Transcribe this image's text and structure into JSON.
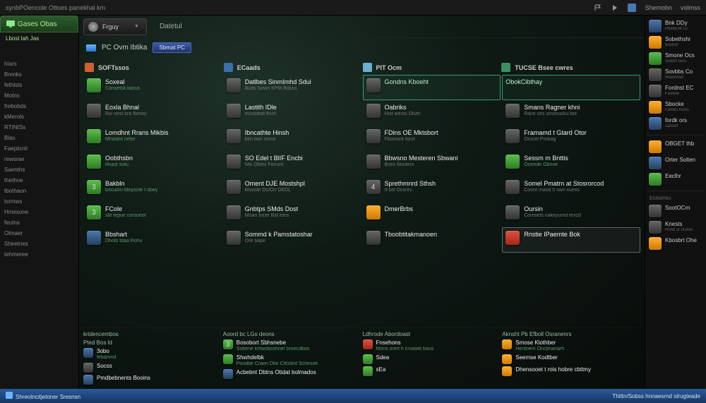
{
  "topbar": {
    "title": "synbPOencole Ottoes panekhal km",
    "right": [
      "Shemobn",
      "volmss"
    ]
  },
  "lsb": {
    "tab": "Gases Obas",
    "sub": "Lbost lah Jas",
    "cats": [
      "hIars",
      "Brenks",
      "fethists",
      "Motns",
      "frebobds",
      "kMerols",
      "RTINISs",
      "Blas",
      "Faeplontl",
      "rewsrae",
      "Saenths",
      "thethoe",
      "tbothaon",
      "tsrmws",
      "Hmesone",
      "feutns",
      "Olmaer",
      "Sheetnes",
      "tehmeree"
    ]
  },
  "hdr": {
    "dd": "Frguy",
    "tab": "Datetul"
  },
  "crumb": {
    "text": "PC Ovm Ibtika",
    "pill": "Sbmat PC"
  },
  "cols": [
    "SOFTssos",
    "ECaads",
    "PIT Ocm",
    "TUCSE Bsee cwres"
  ],
  "colIconColors": [
    "#d06030",
    "#3a70b0",
    "#6ab0d0",
    "#3a9060"
  ],
  "rows": [
    [
      {
        "t1": "Soxeal",
        "t2": "Consetsk kacus",
        "ic": "g"
      },
      {
        "t1": "Datlbes SinmImhd Sdui",
        "t2": "Bods Sown KPM Bdoss",
        "ic": "gy"
      },
      {
        "t1": "Gondns Kboeht",
        "t2": "",
        "ic": "gy",
        "hl": "g"
      },
      {
        "t1": "ObokCibthay",
        "t2": "",
        "ic": "",
        "hl": "g",
        "noicon": true
      }
    ],
    [
      {
        "t1": "Eoxla Bhnal",
        "t2": "Rw nest bra fbmou",
        "ic": "gy"
      },
      {
        "t1": "Lastith IDle",
        "t2": "mcostedt thick",
        "ic": "gy"
      },
      {
        "t1": "Oabriks",
        "t2": "Hist wems Olutn",
        "ic": "gy"
      },
      {
        "t1": "Smans Ragner khni",
        "t2": "Race ces smonucku bot",
        "ic": "gy"
      }
    ],
    [
      {
        "t1": "Lomdhnt Rrans Mikbis",
        "t2": "Mhastnt nehe",
        "ic": "g"
      },
      {
        "t1": "Ibncathte Hinsh",
        "t2": "bkh bon mose",
        "ic": "gy"
      },
      {
        "t1": "FDins OE Mktsbort",
        "t2": "Fbumork forst",
        "ic": "gy"
      },
      {
        "t1": "Framamd t Gtard Otor",
        "t2": "Orocel Probag",
        "ic": "gy"
      }
    ],
    [
      {
        "t1": "Oobthsbn",
        "t2": "Hxast sotu",
        "ic": "g"
      },
      {
        "t1": "SO Edel t BlIF Encbi",
        "t2": "Nts Obles Feeunt",
        "ic": "gy"
      },
      {
        "t1": "Bbwsno Mesteren Sbwani",
        "t2": "Bces Nooters",
        "ic": "gy"
      },
      {
        "t1": "Sessm m Bnttis",
        "t2": "Oonede Obnoe",
        "ic": "g"
      }
    ],
    [
      {
        "t1": "Bakbln",
        "t2": "bocuom btepsste t obey",
        "ic": "g",
        "num": "3"
      },
      {
        "t1": "Oment DJE Mostshpl",
        "t2": "Moosle Do/On DEDL",
        "ic": "gy"
      },
      {
        "t1": "Sprethmnrd Sthsh",
        "t2": "It bel Dosres",
        "ic": "gy",
        "num": "4"
      },
      {
        "t1": "Somel Pmatrn at Stosrorcod",
        "t2": "Coont maod h swn xuexs",
        "ic": "gy"
      }
    ],
    [
      {
        "t1": "FCole",
        "t2": "sbt tepue corsoeot",
        "ic": "g",
        "num": "3"
      },
      {
        "t1": "Gnbtps SMds Dost",
        "t2": "Moan Incer Bot tons",
        "ic": "gy"
      },
      {
        "t1": "DmerBrbs",
        "t2": "",
        "ic": "o"
      },
      {
        "t1": "Oursin",
        "t2": "Comsets nakeyumd texcd",
        "ic": "gy"
      }
    ],
    [
      {
        "t1": "Bbshart",
        "t2": "Dhots tdaa Rohu",
        "ic": "b"
      },
      {
        "t1": "Sommd k Pamstatoshar",
        "t2": "Ore bape",
        "ic": "gy"
      },
      {
        "t1": "Tboobtitakmanoen",
        "t2": "",
        "ic": "gy"
      },
      {
        "t1": "Rnstie IPaemte Bok",
        "t2": "",
        "ic": "r",
        "hl": "b"
      }
    ]
  ],
  "bottom": {
    "heads": [
      "Pted Bos ld",
      "Aoord bc LGs deons",
      "Ldhrode Abordoast",
      "Aknsht Pb Efboll Osranenrs"
    ],
    "lead": [
      "kridencembos",
      "",
      ""
    ],
    "cols": [
      [
        {
          "t1": "3obo",
          "t2": "febanmd",
          "ic": "b"
        },
        {
          "t1": "Socss",
          "t2": "",
          "ic": "gy"
        },
        {
          "t1": "Pmdbebnents Booins",
          "t2": "",
          "ic": "b"
        }
      ],
      [
        {
          "t1": "Bosobort Sbhsnebe",
          "t2": "Sobene kmwsboshnet broecdbos",
          "ic": "g",
          "num": "3"
        },
        {
          "t1": "Shwhdelbk",
          "t2": "Poodbe Craon Dbe Cthobnt Schesoe",
          "ic": "g"
        },
        {
          "t1": "Acbebnt Dbtns Otidat bolmados",
          "t2": "",
          "ic": "b"
        }
      ],
      [
        {
          "t1": "Fnsehons",
          "t2": "Mons orert h croaoet baus",
          "ic": "r"
        },
        {
          "t1": "Sdea",
          "t2": "",
          "ic": "g"
        },
        {
          "t1": "sEa",
          "t2": "",
          "ic": "g"
        }
      ],
      [
        {
          "t1": "Smose Klothber",
          "t2": "Hentoem Oncbnanarh",
          "ic": "o"
        },
        {
          "t1": "Seemse Kodtber",
          "t2": "",
          "ic": "o"
        },
        {
          "t1": "Dhensooet t rois hobre cbttmy",
          "t2": "",
          "ic": "o"
        }
      ]
    ]
  },
  "rsb": [
    {
      "t1": "Bnk DDy",
      "t2": "Pbanoslt 1o",
      "ic": "b"
    },
    {
      "t1": "Sobethshr",
      "t2": "bouhor",
      "ic": "o"
    },
    {
      "t1": "Smone Ocs",
      "t2": "Stdem teos",
      "ic": "g"
    },
    {
      "t1": "Sovbbs Co",
      "t2": "Rbastnod",
      "ic": "gy"
    },
    {
      "t1": "Fordnst EC",
      "t2": "Footete",
      "ic": "gy"
    },
    {
      "t1": "Sbocke",
      "t2": "Fantes Nons",
      "ic": "o"
    },
    {
      "t1": "fordk ors",
      "t2": "sardoft",
      "ic": "b"
    }
  ],
  "rsb2": [
    {
      "t1": "OBGET thb",
      "t2": "",
      "ic": "o"
    },
    {
      "t1": "Orter Solten",
      "t2": "",
      "ic": "b"
    },
    {
      "t1": "Eeclhr",
      "t2": "",
      "ic": "g"
    }
  ],
  "rsbHead": "Eloltdrhks",
  "rsb3": [
    {
      "t1": "SootOCrn",
      "t2": "",
      "ic": "gy"
    },
    {
      "t1": "Knests",
      "t2": "Hond st ot.doo",
      "ic": "gy"
    },
    {
      "t1": "Kbosbrt Ohe",
      "t2": "",
      "ic": "o"
    }
  ],
  "footer": {
    "left": "Shreotncitjetoner Sresnsn",
    "right": "Thittn/Sobss hnnaesrnd strugteade"
  }
}
